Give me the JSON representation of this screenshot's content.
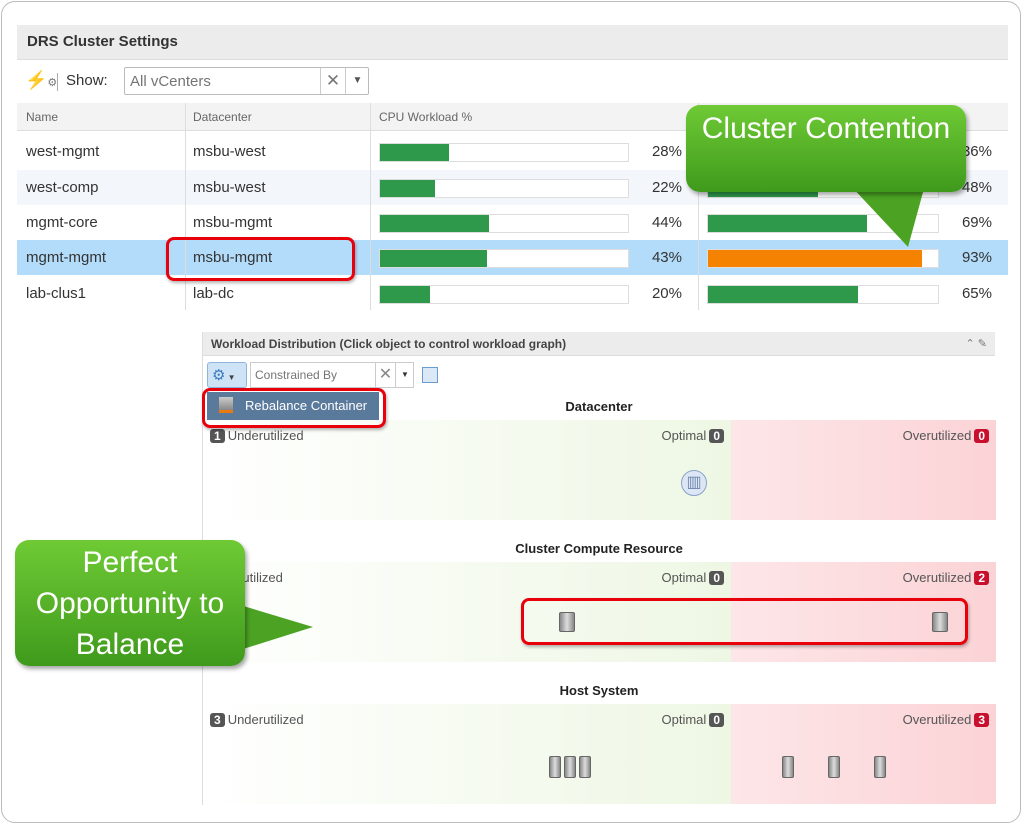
{
  "panel": {
    "title": "DRS Cluster Settings",
    "show_label": "Show:",
    "show_placeholder": "All vCenters",
    "columns": [
      "Name",
      "Datacenter",
      "CPU Workload %"
    ],
    "rows": [
      {
        "name": "west-mgmt",
        "datacenter": "msbu-west",
        "cpu": 28,
        "cpu_label": "28%",
        "mem": 36,
        "mem_label": "36%"
      },
      {
        "name": "west-comp",
        "datacenter": "msbu-west",
        "cpu": 22,
        "cpu_label": "22%",
        "mem": 48,
        "mem_label": "48%"
      },
      {
        "name": "mgmt-core",
        "datacenter": "msbu-mgmt",
        "cpu": 44,
        "cpu_label": "44%",
        "mem": 69,
        "mem_label": "69%"
      },
      {
        "name": "mgmt-mgmt",
        "datacenter": "msbu-mgmt",
        "cpu": 43,
        "cpu_label": "43%",
        "mem": 93,
        "mem_label": "93%",
        "selected": true,
        "mem_color": "#f58200"
      },
      {
        "name": "lab-clus1",
        "datacenter": "lab-dc",
        "cpu": 20,
        "cpu_label": "20%",
        "mem": 65,
        "mem_label": "65%"
      }
    ],
    "bar_color": "#2e994a"
  },
  "workload": {
    "title": "Workload Distribution (Click object to control workload graph)",
    "filter_placeholder": "Constrained By",
    "menu_item": "Rebalance Container",
    "sections": [
      {
        "title": "Datacenter",
        "under": "Underutilized",
        "under_count": "1",
        "optimal": "Optimal",
        "optimal_count": "0",
        "over": "Overutilized",
        "over_count": "0"
      },
      {
        "title": "Cluster Compute Resource",
        "under": "Underutilized",
        "under_count": "",
        "optimal": "Optimal",
        "optimal_count": "0",
        "over": "Overutilized",
        "over_count": "2"
      },
      {
        "title": "Host System",
        "under": "Underutilized",
        "under_count": "3",
        "optimal": "Optimal",
        "optimal_count": "0",
        "over": "Overutilized",
        "over_count": "3"
      }
    ]
  },
  "callouts": {
    "contention": "Cluster Contention",
    "opportunity": "Perfect Opportunity to Balance"
  }
}
